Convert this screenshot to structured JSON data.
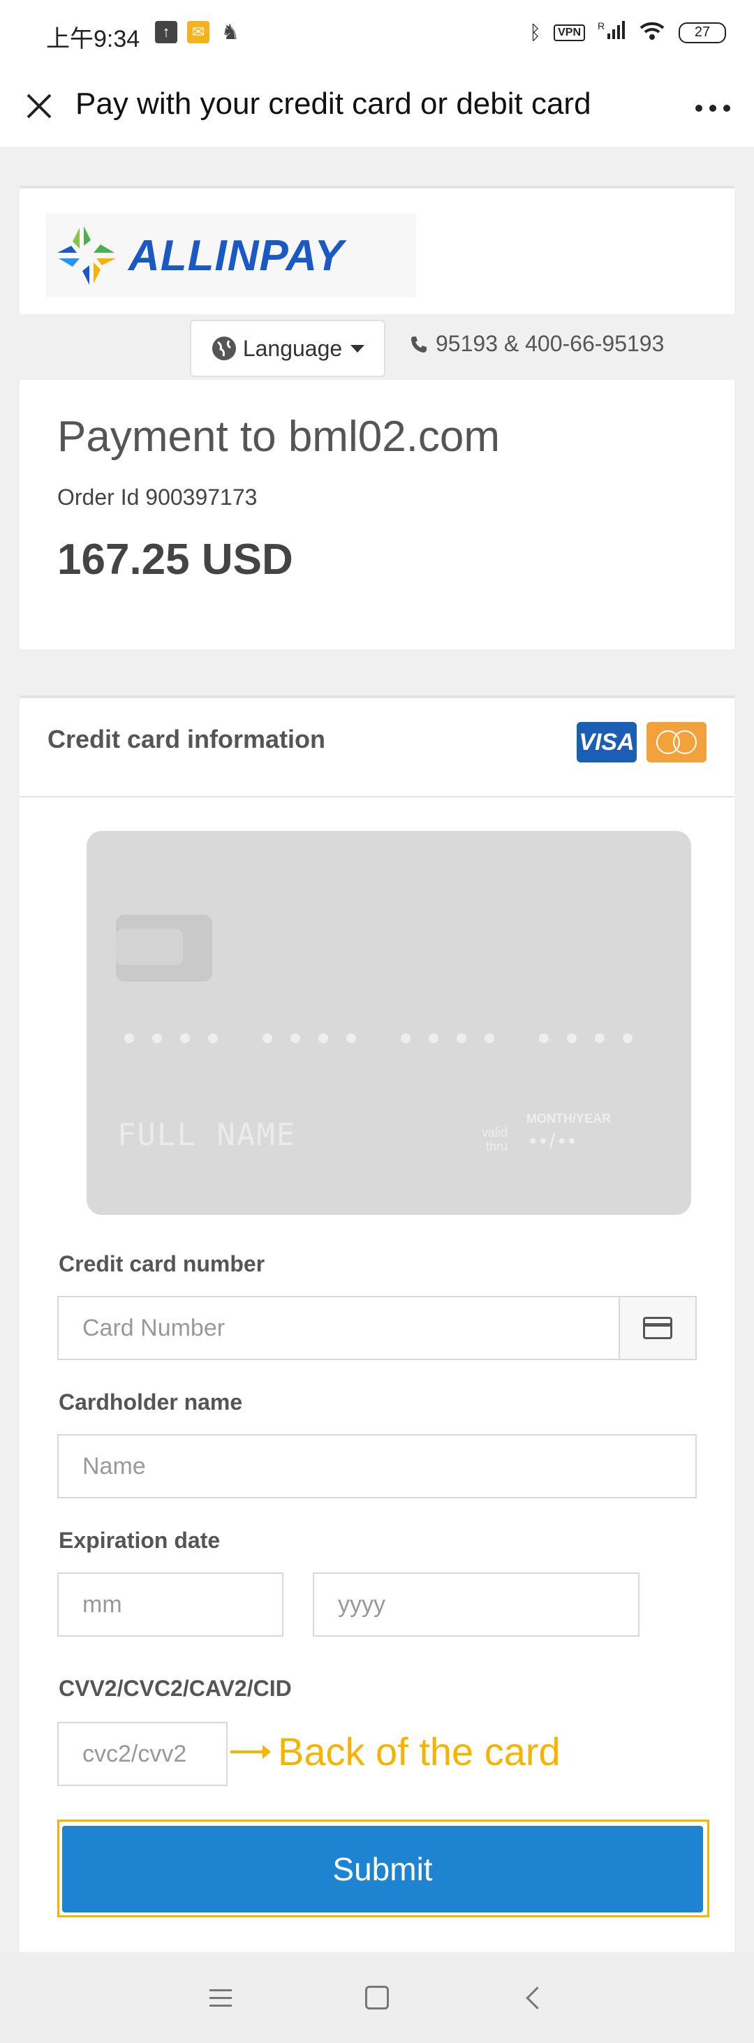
{
  "status_bar": {
    "time": "上午9:34",
    "vpn": "VPN",
    "signal": "R",
    "battery": "27"
  },
  "header": {
    "title": "Pay with your credit card or debit card"
  },
  "merchant": {
    "logo_text": "ALLINPAY",
    "language_label": "Language",
    "phone": "95193 & 400-66-95193",
    "payment_title": "Payment to bml02.com",
    "order_id": "Order Id 900397173",
    "amount": "167.25 USD"
  },
  "credit_card": {
    "section_title": "Credit card information",
    "visa_label": "VISA",
    "card_preview": {
      "full_name": "FULL NAME",
      "valid_thru_line1": "valid",
      "valid_thru_line2": "thru",
      "month_year": "MONTH/YEAR",
      "expiry_dots": "••/••"
    },
    "fields": {
      "card_number_label": "Credit card number",
      "card_number_placeholder": "Card Number",
      "cardholder_label": "Cardholder name",
      "cardholder_placeholder": "Name",
      "expiration_label": "Expiration date",
      "month_placeholder": "mm",
      "year_placeholder": "yyyy",
      "cvv_label": "CVV2/CVC2/CAV2/CID",
      "cvv_placeholder": "cvc2/cvv2"
    },
    "annotation": "Back of the card",
    "submit_label": "Submit"
  },
  "colors": {
    "accent": "#1e84d2",
    "annotation": "#f4b400",
    "logo_blue": "#1a58c6"
  }
}
